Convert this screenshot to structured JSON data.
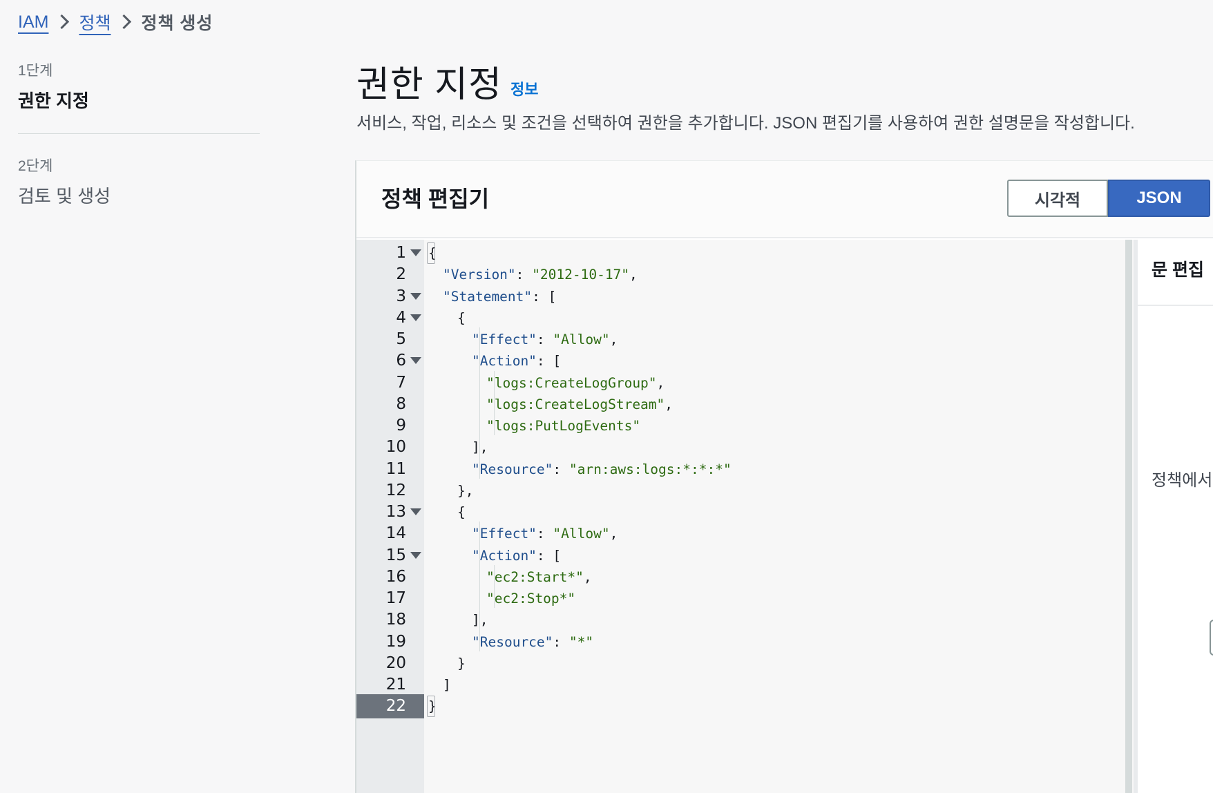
{
  "breadcrumb": [
    {
      "label": "IAM",
      "link": true
    },
    {
      "label": "정책",
      "link": true
    },
    {
      "label": "정책 생성",
      "link": false
    }
  ],
  "steps": [
    {
      "number": "1단계",
      "title": "권한 지정",
      "active": true
    },
    {
      "number": "2단계",
      "title": "검토 및 생성",
      "active": false
    }
  ],
  "header": {
    "title": "권한 지정",
    "info": "정보",
    "description": "서비스, 작업, 리소스 및 조건을 선택하여 권한을 추가합니다. JSON 편집기를 사용하여 권한 설명문을 작성합니다."
  },
  "editor": {
    "title": "정책 편집기",
    "mode_visual": "시각적",
    "mode_json": "JSON",
    "active_mode": "JSON",
    "active_line": 22,
    "lines": [
      {
        "n": "1",
        "fold": true,
        "indent": 0,
        "tokens": [
          [
            "p",
            "{"
          ]
        ]
      },
      {
        "n": "2",
        "fold": false,
        "indent": 1,
        "tokens": [
          [
            "k",
            "\"Version\""
          ],
          [
            "p",
            ": "
          ],
          [
            "s",
            "\"2012-10-17\""
          ],
          [
            "p",
            ","
          ]
        ]
      },
      {
        "n": "3",
        "fold": true,
        "indent": 1,
        "tokens": [
          [
            "k",
            "\"Statement\""
          ],
          [
            "p",
            ": ["
          ]
        ]
      },
      {
        "n": "4",
        "fold": true,
        "indent": 2,
        "tokens": [
          [
            "p",
            "{"
          ]
        ]
      },
      {
        "n": "5",
        "fold": false,
        "indent": 3,
        "tokens": [
          [
            "k",
            "\"Effect\""
          ],
          [
            "p",
            ": "
          ],
          [
            "s",
            "\"Allow\""
          ],
          [
            "p",
            ","
          ]
        ]
      },
      {
        "n": "6",
        "fold": true,
        "indent": 3,
        "tokens": [
          [
            "k",
            "\"Action\""
          ],
          [
            "p",
            ": ["
          ]
        ]
      },
      {
        "n": "7",
        "fold": false,
        "indent": 4,
        "tokens": [
          [
            "s",
            "\"logs:CreateLogGroup\""
          ],
          [
            "p",
            ","
          ]
        ]
      },
      {
        "n": "8",
        "fold": false,
        "indent": 4,
        "tokens": [
          [
            "s",
            "\"logs:CreateLogStream\""
          ],
          [
            "p",
            ","
          ]
        ]
      },
      {
        "n": "9",
        "fold": false,
        "indent": 4,
        "tokens": [
          [
            "s",
            "\"logs:PutLogEvents\""
          ]
        ]
      },
      {
        "n": "10",
        "fold": false,
        "indent": 3,
        "tokens": [
          [
            "p",
            "],"
          ]
        ]
      },
      {
        "n": "11",
        "fold": false,
        "indent": 3,
        "tokens": [
          [
            "k",
            "\"Resource\""
          ],
          [
            "p",
            ": "
          ],
          [
            "s",
            "\"arn:aws:logs:*:*:*\""
          ]
        ]
      },
      {
        "n": "12",
        "fold": false,
        "indent": 2,
        "tokens": [
          [
            "p",
            "},"
          ]
        ]
      },
      {
        "n": "13",
        "fold": true,
        "indent": 2,
        "tokens": [
          [
            "p",
            "{"
          ]
        ]
      },
      {
        "n": "14",
        "fold": false,
        "indent": 3,
        "tokens": [
          [
            "k",
            "\"Effect\""
          ],
          [
            "p",
            ": "
          ],
          [
            "s",
            "\"Allow\""
          ],
          [
            "p",
            ","
          ]
        ]
      },
      {
        "n": "15",
        "fold": true,
        "indent": 3,
        "tokens": [
          [
            "k",
            "\"Action\""
          ],
          [
            "p",
            ": ["
          ]
        ]
      },
      {
        "n": "16",
        "fold": false,
        "indent": 4,
        "tokens": [
          [
            "s",
            "\"ec2:Start*\""
          ],
          [
            "p",
            ","
          ]
        ]
      },
      {
        "n": "17",
        "fold": false,
        "indent": 4,
        "tokens": [
          [
            "s",
            "\"ec2:Stop*\""
          ]
        ]
      },
      {
        "n": "18",
        "fold": false,
        "indent": 3,
        "tokens": [
          [
            "p",
            "],"
          ]
        ]
      },
      {
        "n": "19",
        "fold": false,
        "indent": 3,
        "tokens": [
          [
            "k",
            "\"Resource\""
          ],
          [
            "p",
            ": "
          ],
          [
            "s",
            "\"*\""
          ]
        ]
      },
      {
        "n": "20",
        "fold": false,
        "indent": 2,
        "tokens": [
          [
            "p",
            "}"
          ]
        ]
      },
      {
        "n": "21",
        "fold": false,
        "indent": 1,
        "tokens": [
          [
            "p",
            "]"
          ]
        ]
      },
      {
        "n": "22",
        "fold": false,
        "indent": 0,
        "tokens": [
          [
            "p",
            "}"
          ]
        ]
      }
    ]
  },
  "side_pane": {
    "title": "문 편집",
    "text": "정책에서"
  },
  "colors": {
    "link": "#3063b9",
    "info": "#0972d3",
    "json_active": "#3869c0",
    "key": "#1f4e8c",
    "string": "#2e6b12"
  }
}
